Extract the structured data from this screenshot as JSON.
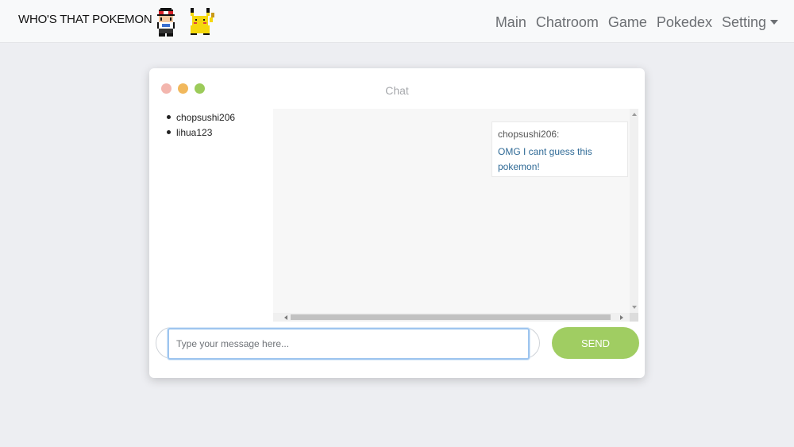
{
  "navbar": {
    "brand": "WHO'S THAT POKEMON",
    "links": [
      "Main",
      "Chatroom",
      "Game",
      "Pokedex",
      "Setting"
    ]
  },
  "icons": {
    "trainer": "trainer-sprite-icon",
    "pikachu": "pikachu-sprite-icon",
    "setting_caret": "caret-down-icon"
  },
  "chat": {
    "title": "Chat",
    "users": [
      "chopsushi206",
      "lihua123"
    ],
    "messages": [
      {
        "user": "chopsushi206:",
        "text": "OMG I cant guess this pokemon!"
      }
    ],
    "input": {
      "value": "",
      "placeholder": "Type your message here..."
    },
    "send_label": "SEND"
  },
  "colors": {
    "background": "#edeef2",
    "send_button": "#a0cd62",
    "message_text": "#2f6a96",
    "dot_red": "#f3b6ae",
    "dot_yellow": "#f1b85c",
    "dot_green": "#9ccb5a"
  }
}
